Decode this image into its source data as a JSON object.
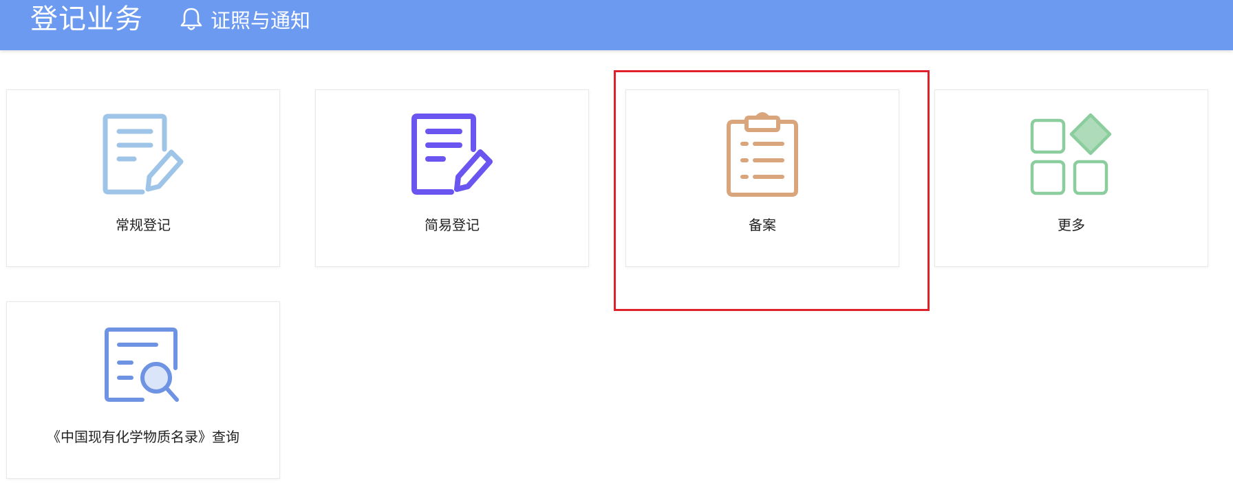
{
  "header": {
    "title": "登记业务",
    "notice_link": "证照与通知",
    "background": "#6b9af0"
  },
  "cards": [
    {
      "label": "常规登记",
      "icon": "edit-document-icon",
      "color": "#9ec5e8"
    },
    {
      "label": "简易登记",
      "icon": "edit-document-icon",
      "color": "#6a55f0"
    },
    {
      "label": "备案",
      "icon": "clipboard-list-icon",
      "color": "#d9a57c",
      "highlighted": true
    },
    {
      "label": "更多",
      "icon": "apps-grid-icon",
      "color": "#8ccd9e"
    },
    {
      "label": "《中国现有化学物质名录》查询",
      "icon": "document-search-icon",
      "color": "#6e93e3"
    }
  ],
  "highlight_color": "#e0212b"
}
